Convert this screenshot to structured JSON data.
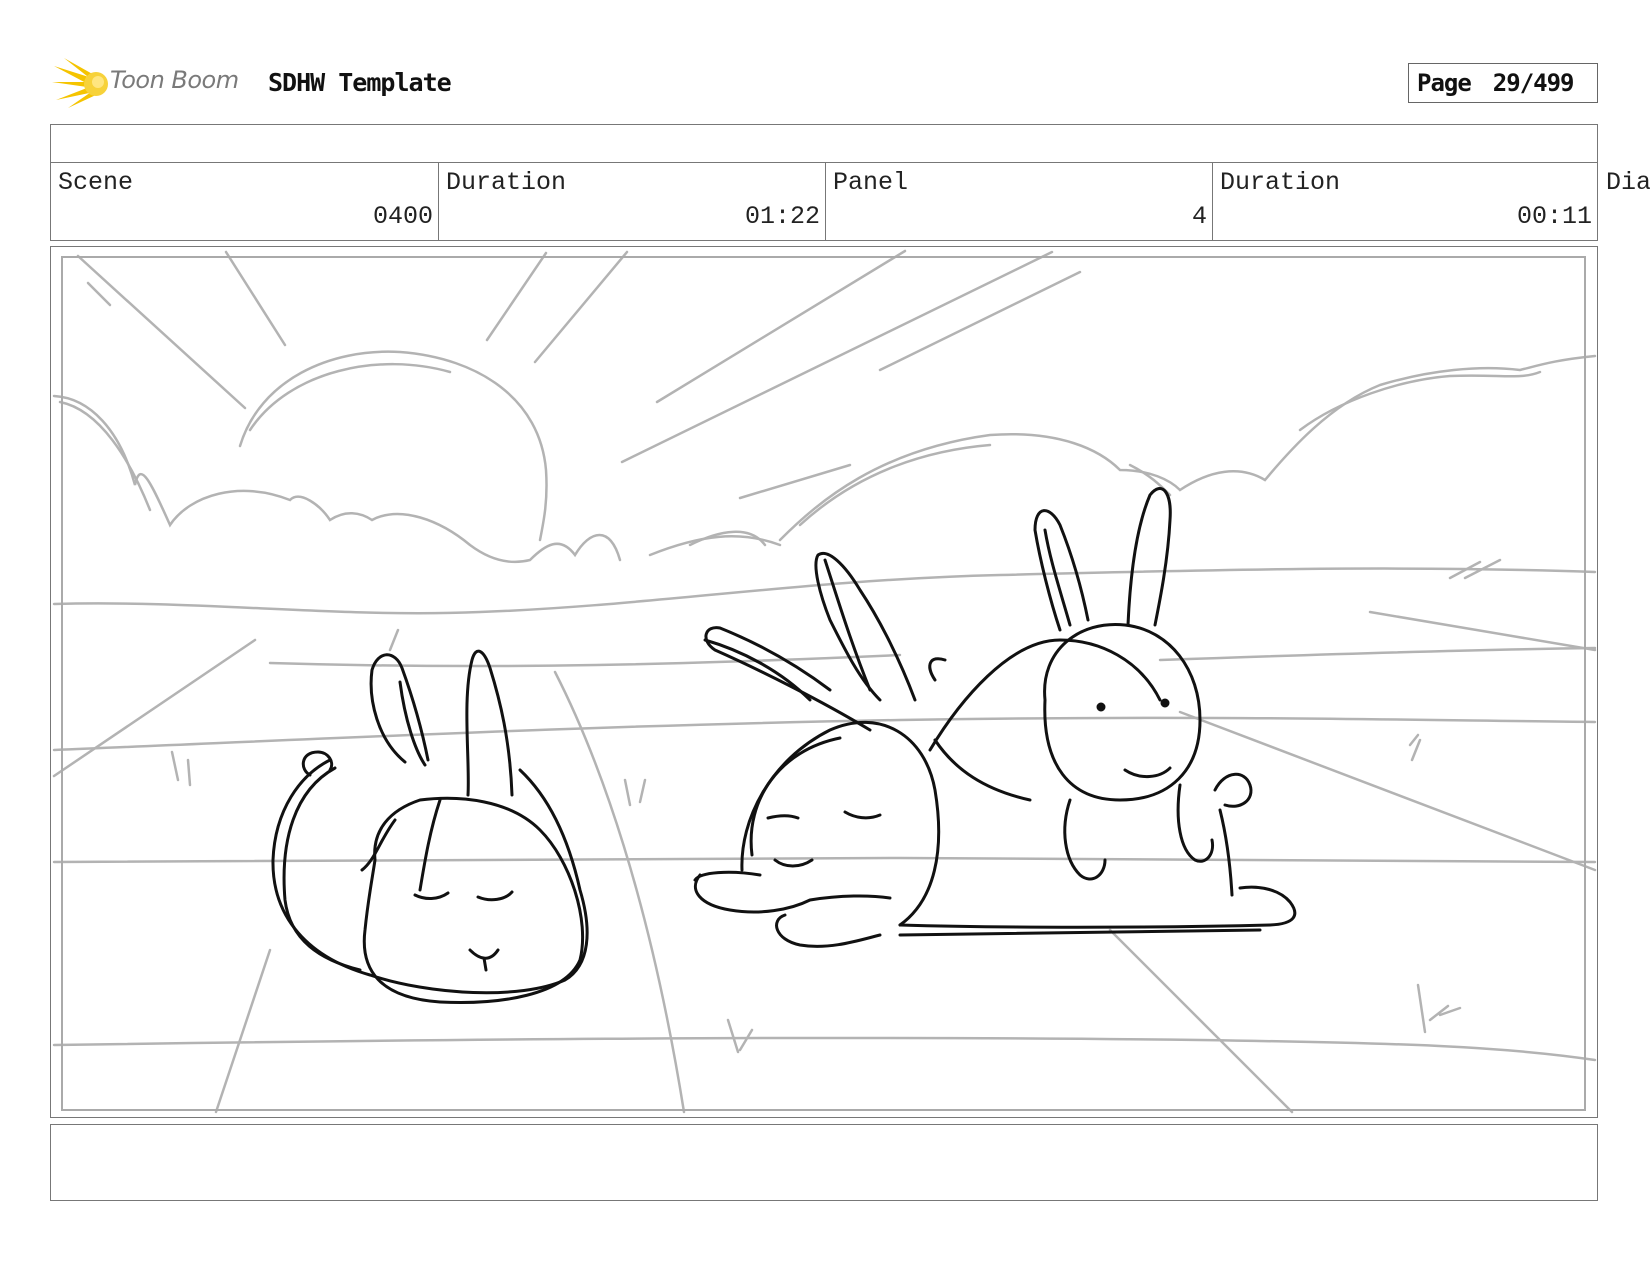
{
  "header": {
    "logo_text": "Toon Boom",
    "title": "SDHW Template",
    "page_label": "Page",
    "page_number": "29/499"
  },
  "info_row": {
    "scene_label": "Scene",
    "scene_value": "0400",
    "scene_duration_label": "Duration",
    "scene_duration_value": "01:22",
    "panel_label": "Panel",
    "panel_value": "4",
    "panel_duration_label": "Duration",
    "panel_duration_value": "00:11",
    "dialogue_label_partial": "Dia"
  },
  "colors": {
    "background_lines": "#b3b3b3",
    "character_lines": "#111111",
    "logo_accent": "#f5c400"
  }
}
